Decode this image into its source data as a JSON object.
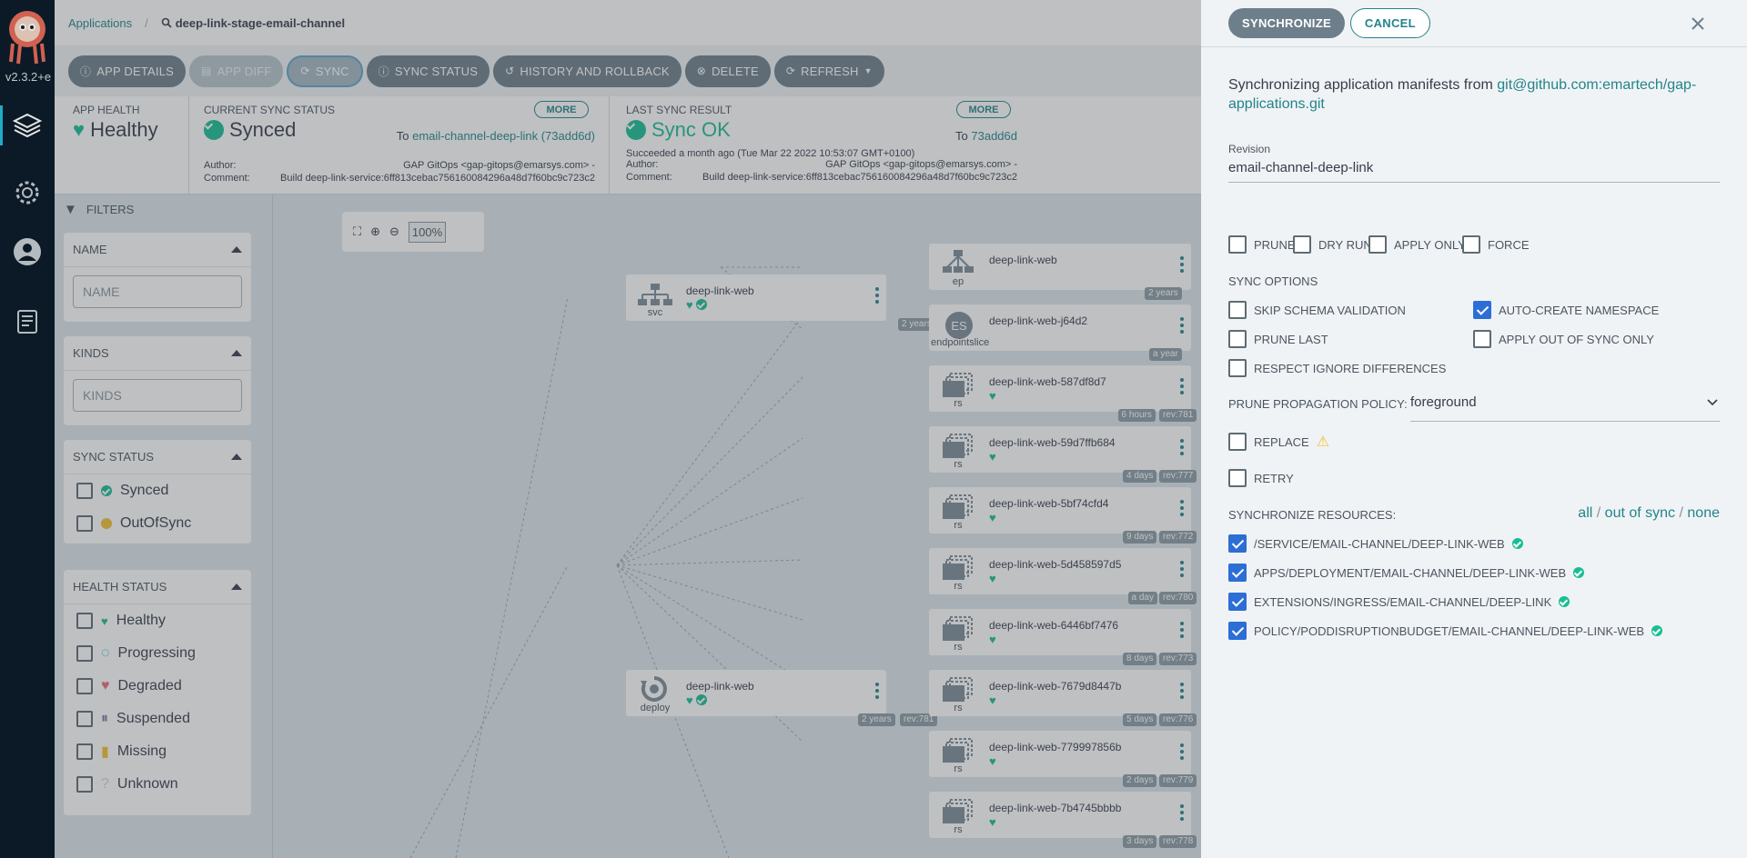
{
  "nav": {
    "version": "v2.3.2+e"
  },
  "breadcrumb": {
    "root": "Applications",
    "current": "deep-link-stage-email-channel"
  },
  "toolbar": {
    "app_details": "APP DETAILS",
    "app_diff": "APP DIFF",
    "sync": "SYNC",
    "sync_status": "SYNC STATUS",
    "history": "HISTORY AND ROLLBACK",
    "delete": "DELETE",
    "refresh": "REFRESH"
  },
  "status": {
    "app_health_label": "APP HEALTH",
    "app_health": "Healthy",
    "current_sync_label": "CURRENT SYNC STATUS",
    "current_sync": "Synced",
    "more": "MORE",
    "to_prefix": "To",
    "current_to": "email-channel-deep-link (73add6d)",
    "author_label": "Author:",
    "author": "GAP GitOps <gap-gitops@emarsys.com> -",
    "comment_label": "Comment:",
    "comment": "Build deep-link-service:6ff813cebac756160084296a48d7f60bc9c723c2",
    "last_sync_label": "LAST SYNC RESULT",
    "last_sync": "Sync OK",
    "last_to": "73add6d",
    "succeeded": "Succeeded a month ago (Tue Mar 22 2022 10:53:07 GMT+0100)"
  },
  "filters": {
    "title": "FILTERS",
    "name_title": "NAME",
    "name_placeholder": "NAME",
    "kinds_title": "KINDS",
    "kinds_placeholder": "KINDS",
    "sync_title": "SYNC STATUS",
    "sync_options": [
      "Synced",
      "OutOfSync"
    ],
    "health_title": "HEALTH STATUS",
    "health_options": [
      "Healthy",
      "Progressing",
      "Degraded",
      "Suspended",
      "Missing",
      "Unknown"
    ]
  },
  "zoom": {
    "level": "100%"
  },
  "graph": {
    "svc": {
      "name": "deep-link-web",
      "kind": "svc",
      "age": "2 years"
    },
    "deploy": {
      "name": "deep-link-web",
      "kind": "deploy",
      "age": "2 years",
      "rev": "rev:781"
    },
    "ep": {
      "name": "deep-link-web",
      "kind": "ep",
      "age": "2 years"
    },
    "eps": {
      "name": "deep-link-web-j64d2",
      "kind": "endpointslice",
      "icon": "ES",
      "age": "a year"
    },
    "replicasets": [
      {
        "name": "deep-link-web-587df8d7",
        "age": "6 hours",
        "rev": "rev:781"
      },
      {
        "name": "deep-link-web-59d7ffb684",
        "age": "4 days",
        "rev": "rev:777"
      },
      {
        "name": "deep-link-web-5bf74cfd4",
        "age": "9 days",
        "rev": "rev:772"
      },
      {
        "name": "deep-link-web-5d458597d5",
        "age": "a day",
        "rev": "rev:780"
      },
      {
        "name": "deep-link-web-6446bf7476",
        "age": "8 days",
        "rev": "rev:773"
      },
      {
        "name": "deep-link-web-7679d8447b",
        "age": "5 days",
        "rev": "rev:776"
      },
      {
        "name": "deep-link-web-779997856b",
        "age": "2 days",
        "rev": "rev:779"
      },
      {
        "name": "deep-link-web-7b4745bbbb",
        "age": "3 days",
        "rev": "rev:778"
      }
    ],
    "rs_kind": "rs"
  },
  "panel": {
    "synchronize": "SYNCHRONIZE",
    "cancel": "CANCEL",
    "intro": "Synchronizing application manifests from",
    "repo": "git@github.com:emartech/gap-applications.git",
    "revision_label": "Revision",
    "revision": "email-channel-deep-link",
    "prune": "PRUNE",
    "dry_run": "DRY RUN",
    "apply_only": "APPLY ONLY",
    "force": "FORCE",
    "sync_options_label": "SYNC OPTIONS",
    "skip_schema": "SKIP SCHEMA VALIDATION",
    "auto_create_ns": "AUTO-CREATE NAMESPACE",
    "prune_last": "PRUNE LAST",
    "apply_oos": "APPLY OUT OF SYNC ONLY",
    "respect_ignore": "RESPECT IGNORE DIFFERENCES",
    "ppp_label": "PRUNE PROPAGATION POLICY:",
    "ppp_value": "foreground",
    "replace": "REPLACE",
    "retry": "RETRY",
    "resources_label": "SYNCHRONIZE RESOURCES:",
    "all": "all",
    "out_of_sync": "out of sync",
    "none": "none",
    "sep": "/",
    "resources": [
      "/SERVICE/EMAIL-CHANNEL/DEEP-LINK-WEB",
      "APPS/DEPLOYMENT/EMAIL-CHANNEL/DEEP-LINK-WEB",
      "EXTENSIONS/INGRESS/EMAIL-CHANNEL/DEEP-LINK",
      "POLICY/PODDISRUPTIONBUDGET/EMAIL-CHANNEL/DEEP-LINK-WEB"
    ]
  },
  "colors": {
    "accent": "#22848a",
    "healthy": "#18be94",
    "nav": "#0d1d2b",
    "checked": "#2c6ed5"
  }
}
